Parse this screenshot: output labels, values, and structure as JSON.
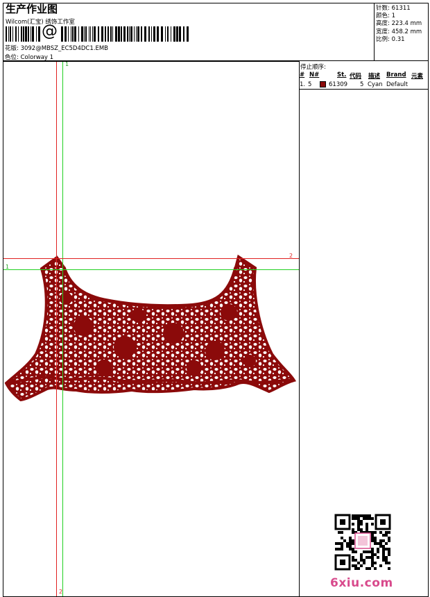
{
  "header": {
    "title": "生产作业图",
    "company": "Wilcom(汇宝) 绣饰工作室",
    "barcode_symbol": "@",
    "design_label": "花版:",
    "design_value": "3092@MBSZ_EC5D4DC1.EMB",
    "colorway_label": "色位:",
    "colorway_value": "Colorway 1"
  },
  "stats": [
    {
      "label": "针数",
      "value": "61311"
    },
    {
      "label": "颜色",
      "value": "1"
    },
    {
      "label": "高度",
      "value": "223.4 mm"
    },
    {
      "label": "宽度",
      "value": "458.2 mm"
    },
    {
      "label": "比例",
      "value": "0.31"
    }
  ],
  "stop_sequence": {
    "title": "停止顺序:",
    "columns": [
      "#",
      "N#",
      "St.",
      "代码",
      "描述",
      "Brand",
      "元素"
    ],
    "rows": [
      {
        "index": "1.",
        "needle": "5",
        "swatch_color": "#8b0a0a",
        "stitches": "61309",
        "code": "5",
        "description": "Cyan",
        "brand": "Default"
      }
    ]
  },
  "guides": {
    "h1": "1",
    "h2": "2",
    "v1": "1",
    "v2": "2"
  },
  "colors": {
    "embroidery": "#8b0a0a",
    "guide_red": "#e02020",
    "guide_green": "#20d020",
    "logo": "#d84a8c"
  },
  "watermark": {
    "text": "6xiu.com"
  }
}
